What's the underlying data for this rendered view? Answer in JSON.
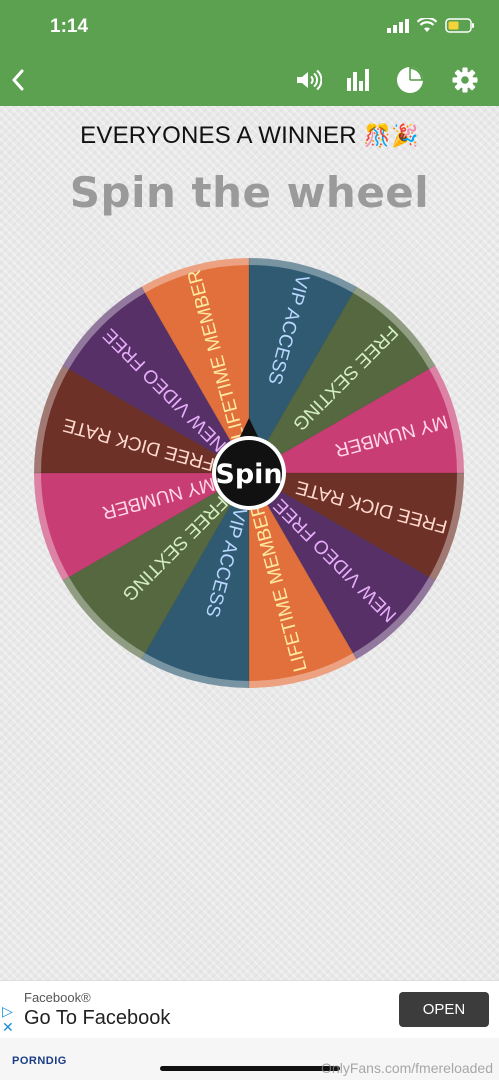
{
  "status_bar": {
    "time": "1:14"
  },
  "toolbar": {
    "back_icon": "chevron-left-icon",
    "sound_icon": "speaker-icon",
    "stats_icon": "bar-chart-icon",
    "pie_icon": "pie-chart-icon",
    "settings_icon": "gear-icon",
    "color": "#5ba14f"
  },
  "headline": {
    "text": "EVERYONES A WINNER",
    "emoji": "🎊🎉"
  },
  "subtitle": "Spin the wheel",
  "wheel": {
    "spin_label": "Spin",
    "segments": [
      {
        "label": "VIP ACCESS",
        "color": "#2f5a72",
        "text_color": "#b9d7ff"
      },
      {
        "label": "FREE SEXTING",
        "color": "#55683f",
        "text_color": "#d4efc0"
      },
      {
        "label": "MY NUMBER",
        "color": "#c83e74",
        "text_color": "#ffd7e6"
      },
      {
        "label": "FREE DICK RATE",
        "color": "#6e3128",
        "text_color": "#ffd9cf"
      },
      {
        "label": "NEW VIDEO FREE",
        "color": "#573068",
        "text_color": "#e6aef8"
      },
      {
        "label": "LIFETIME MEMBER",
        "color": "#e2703d",
        "text_color": "#ffe9a0"
      },
      {
        "label": "VIP ACCESS",
        "color": "#2f5a72",
        "text_color": "#b9d7ff"
      },
      {
        "label": "FREE SEXTING",
        "color": "#55683f",
        "text_color": "#d4efc0"
      },
      {
        "label": "MY NUMBER",
        "color": "#c83e74",
        "text_color": "#ffd7e6"
      },
      {
        "label": "FREE DICK RATE",
        "color": "#6e3128",
        "text_color": "#ffd9cf"
      },
      {
        "label": "NEW VIDEO FREE",
        "color": "#573068",
        "text_color": "#e6aef8"
      },
      {
        "label": "LIFETIME MEMBER",
        "color": "#e2703d",
        "text_color": "#ffe9a0"
      }
    ]
  },
  "ad": {
    "sponsor": "Facebook®",
    "headline": "Go To Facebook",
    "button_label": "OPEN"
  },
  "footer": {
    "brand": "PORNDIG",
    "watermark": "OnlyFans.com/fmereloaded"
  }
}
